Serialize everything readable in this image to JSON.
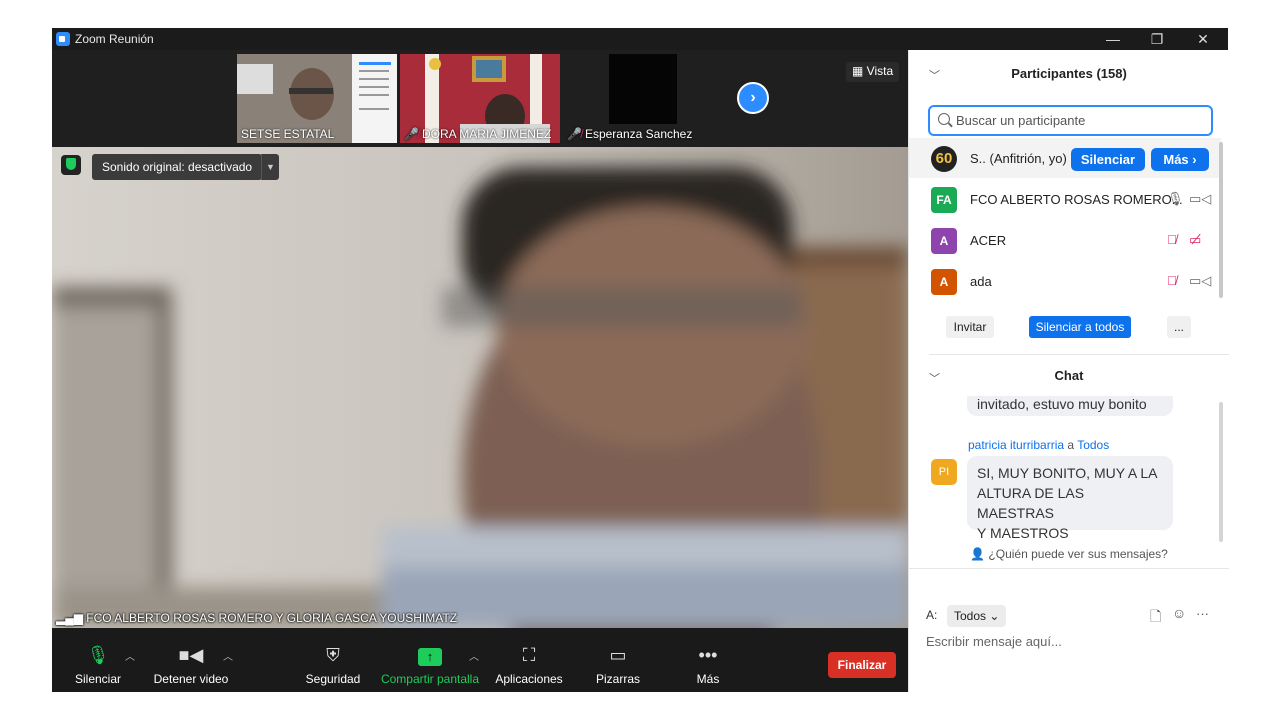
{
  "window": {
    "title": "Zoom Reunión",
    "controls": [
      "—",
      "❐",
      "✕"
    ]
  },
  "strip": {
    "thumbs": [
      {
        "name": "SETSE ESTATAL",
        "muted": false
      },
      {
        "name": "DORA MARIA JIMENEZ",
        "muted": true
      },
      {
        "name": "Esperanza Sanchez",
        "muted": true
      }
    ],
    "view_label": "Vista"
  },
  "video": {
    "sound_label": "Sonido original: desactivado",
    "speaker_name": "FCO ALBERTO ROSAS ROMERO Y GLORIA GASCA YOUSHIMATZ"
  },
  "toolbar": {
    "mute": "Silenciar",
    "stop_video": "Detener video",
    "security": "Seguridad",
    "share": "Compartir pantalla",
    "apps": "Aplicaciones",
    "whiteboards": "Pizarras",
    "more": "Más",
    "end": "Finalizar"
  },
  "participants": {
    "title": "Participantes (158)",
    "search_placeholder": "Buscar un participante",
    "rows": [
      {
        "avatar": "60",
        "name": "S.. (Anfitrión, yo)",
        "color": "#222222"
      },
      {
        "avatar": "FA",
        "name": "FCO ALBERTO ROSAS ROMERO...",
        "color": "#1aaa55"
      },
      {
        "avatar": "A",
        "name": "ACER",
        "color": "#8e44ad"
      },
      {
        "avatar": "A",
        "name": "ada",
        "color": "#d35400"
      }
    ],
    "host_mute": "Silenciar",
    "host_more": "Más ›",
    "invite": "Invitar",
    "mute_all": "Silenciar a todos",
    "more_dots": "..."
  },
  "chat": {
    "title": "Chat",
    "prev_message_tail": "invitado, estuvo muy bonito",
    "sender": "patricia iturribarria",
    "to_word": "a",
    "recipient": "Todos",
    "avatar": "PI",
    "message_lines": [
      "SI, MUY BONITO, MUY A LA",
      "ALTURA DE LAS MAESTRAS",
      "Y MAESTROS"
    ],
    "who_can_see": "¿Quién puede ver sus mensajes?",
    "to_label": "A:",
    "to_value": "Todos",
    "input_placeholder": "Escribir mensaje aquí...",
    "more_dots": "···"
  },
  "colors": {
    "accent": "#0e72ed",
    "end": "#d93025",
    "share_green": "#1dcc5a"
  }
}
